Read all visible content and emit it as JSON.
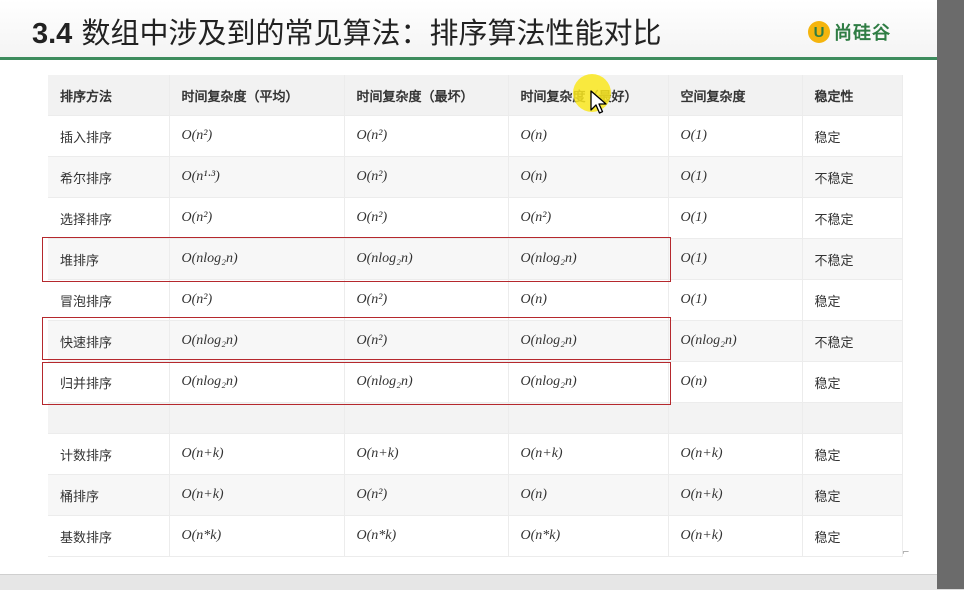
{
  "slide": {
    "title_number": "3.4",
    "title_text": "数组中涉及到的常见算法：排序算法性能对比",
    "brand_mark": "U",
    "brand_name": "尚硅谷"
  },
  "table": {
    "headers": [
      "排序方法",
      "时间复杂度（平均）",
      "时间复杂度（最坏）",
      "时间复杂度（最好）",
      "空间复杂度",
      "稳定性"
    ],
    "rows": [
      [
        "插入排序",
        "O(n²)",
        "O(n²)",
        "O(n)",
        "O(1)",
        "稳定"
      ],
      [
        "希尔排序",
        "O(n¹·³)",
        "O(n²)",
        "O(n)",
        "O(1)",
        "不稳定"
      ],
      [
        "选择排序",
        "O(n²)",
        "O(n²)",
        "O(n²)",
        "O(1)",
        "不稳定"
      ],
      [
        "堆排序",
        "O(nlog₂n)",
        "O(nlog₂n)",
        "O(nlog₂n)",
        "O(1)",
        "不稳定"
      ],
      [
        "冒泡排序",
        "O(n²)",
        "O(n²)",
        "O(n)",
        "O(1)",
        "稳定"
      ],
      [
        "快速排序",
        "O(nlog₂n)",
        "O(n²)",
        "O(nlog₂n)",
        "O(nlog₂n)",
        "不稳定"
      ],
      [
        "归并排序",
        "O(nlog₂n)",
        "O(nlog₂n)",
        "O(nlog₂n)",
        "O(n)",
        "稳定"
      ],
      [
        "",
        "",
        "",
        "",
        "",
        ""
      ],
      [
        "计数排序",
        "O(n+k)",
        "O(n+k)",
        "O(n+k)",
        "O(n+k)",
        "稳定"
      ],
      [
        "桶排序",
        "O(n+k)",
        "O(n²)",
        "O(n)",
        "O(n+k)",
        "稳定"
      ],
      [
        "基数排序",
        "O(n*k)",
        "O(n*k)",
        "O(n*k)",
        "O(n+k)",
        "稳定"
      ]
    ]
  },
  "highlights": [
    "堆排序",
    "快速排序",
    "归并排序"
  ],
  "colors": {
    "accent_green": "#3d8c5d",
    "highlight_red": "#b5282d",
    "brand_yellow": "#f5b50e",
    "cursor_halo": "#fae81e"
  }
}
